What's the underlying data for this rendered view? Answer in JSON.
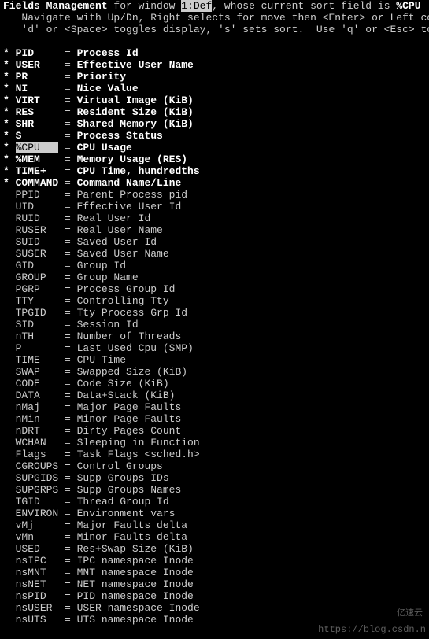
{
  "header": {
    "title_bold": "Fields Management",
    "for_window": " for window ",
    "window_label": "1:Def",
    "mid": ", whose current sort field is ",
    "sort_field": "%CPU",
    "help1": "   Navigate with Up/Dn, Right selects for move then <Enter> or Left commits,",
    "help2": "   'd' or <Space> toggles display, 's' sets sort.  Use 'q' or <Esc> to end!"
  },
  "fields": [
    {
      "on": true,
      "sel": false,
      "name": "PID",
      "desc": "Process Id"
    },
    {
      "on": true,
      "sel": false,
      "name": "USER",
      "desc": "Effective User Name"
    },
    {
      "on": true,
      "sel": false,
      "name": "PR",
      "desc": "Priority"
    },
    {
      "on": true,
      "sel": false,
      "name": "NI",
      "desc": "Nice Value"
    },
    {
      "on": true,
      "sel": false,
      "name": "VIRT",
      "desc": "Virtual Image (KiB)"
    },
    {
      "on": true,
      "sel": false,
      "name": "RES",
      "desc": "Resident Size (KiB)"
    },
    {
      "on": true,
      "sel": false,
      "name": "SHR",
      "desc": "Shared Memory (KiB)"
    },
    {
      "on": true,
      "sel": false,
      "name": "S",
      "desc": "Process Status"
    },
    {
      "on": true,
      "sel": true,
      "name": "%CPU",
      "desc": "CPU Usage"
    },
    {
      "on": true,
      "sel": false,
      "name": "%MEM",
      "desc": "Memory Usage (RES)"
    },
    {
      "on": true,
      "sel": false,
      "name": "TIME+",
      "desc": "CPU Time, hundredths"
    },
    {
      "on": true,
      "sel": false,
      "name": "COMMAND",
      "desc": "Command Name/Line"
    },
    {
      "on": false,
      "sel": false,
      "name": "PPID",
      "desc": "Parent Process pid"
    },
    {
      "on": false,
      "sel": false,
      "name": "UID",
      "desc": "Effective User Id"
    },
    {
      "on": false,
      "sel": false,
      "name": "RUID",
      "desc": "Real User Id"
    },
    {
      "on": false,
      "sel": false,
      "name": "RUSER",
      "desc": "Real User Name"
    },
    {
      "on": false,
      "sel": false,
      "name": "SUID",
      "desc": "Saved User Id"
    },
    {
      "on": false,
      "sel": false,
      "name": "SUSER",
      "desc": "Saved User Name"
    },
    {
      "on": false,
      "sel": false,
      "name": "GID",
      "desc": "Group Id"
    },
    {
      "on": false,
      "sel": false,
      "name": "GROUP",
      "desc": "Group Name"
    },
    {
      "on": false,
      "sel": false,
      "name": "PGRP",
      "desc": "Process Group Id"
    },
    {
      "on": false,
      "sel": false,
      "name": "TTY",
      "desc": "Controlling Tty"
    },
    {
      "on": false,
      "sel": false,
      "name": "TPGID",
      "desc": "Tty Process Grp Id"
    },
    {
      "on": false,
      "sel": false,
      "name": "SID",
      "desc": "Session Id"
    },
    {
      "on": false,
      "sel": false,
      "name": "nTH",
      "desc": "Number of Threads"
    },
    {
      "on": false,
      "sel": false,
      "name": "P",
      "desc": "Last Used Cpu (SMP)"
    },
    {
      "on": false,
      "sel": false,
      "name": "TIME",
      "desc": "CPU Time"
    },
    {
      "on": false,
      "sel": false,
      "name": "SWAP",
      "desc": "Swapped Size (KiB)"
    },
    {
      "on": false,
      "sel": false,
      "name": "CODE",
      "desc": "Code Size (KiB)"
    },
    {
      "on": false,
      "sel": false,
      "name": "DATA",
      "desc": "Data+Stack (KiB)"
    },
    {
      "on": false,
      "sel": false,
      "name": "nMaj",
      "desc": "Major Page Faults"
    },
    {
      "on": false,
      "sel": false,
      "name": "nMin",
      "desc": "Minor Page Faults"
    },
    {
      "on": false,
      "sel": false,
      "name": "nDRT",
      "desc": "Dirty Pages Count"
    },
    {
      "on": false,
      "sel": false,
      "name": "WCHAN",
      "desc": "Sleeping in Function"
    },
    {
      "on": false,
      "sel": false,
      "name": "Flags",
      "desc": "Task Flags <sched.h>"
    },
    {
      "on": false,
      "sel": false,
      "name": "CGROUPS",
      "desc": "Control Groups"
    },
    {
      "on": false,
      "sel": false,
      "name": "SUPGIDS",
      "desc": "Supp Groups IDs"
    },
    {
      "on": false,
      "sel": false,
      "name": "SUPGRPS",
      "desc": "Supp Groups Names"
    },
    {
      "on": false,
      "sel": false,
      "name": "TGID",
      "desc": "Thread Group Id"
    },
    {
      "on": false,
      "sel": false,
      "name": "ENVIRON",
      "desc": "Environment vars"
    },
    {
      "on": false,
      "sel": false,
      "name": "vMj",
      "desc": "Major Faults delta"
    },
    {
      "on": false,
      "sel": false,
      "name": "vMn",
      "desc": "Minor Faults delta"
    },
    {
      "on": false,
      "sel": false,
      "name": "USED",
      "desc": "Res+Swap Size (KiB)"
    },
    {
      "on": false,
      "sel": false,
      "name": "nsIPC",
      "desc": "IPC namespace Inode"
    },
    {
      "on": false,
      "sel": false,
      "name": "nsMNT",
      "desc": "MNT namespace Inode"
    },
    {
      "on": false,
      "sel": false,
      "name": "nsNET",
      "desc": "NET namespace Inode"
    },
    {
      "on": false,
      "sel": false,
      "name": "nsPID",
      "desc": "PID namespace Inode"
    },
    {
      "on": false,
      "sel": false,
      "name": "nsUSER",
      "desc": "USER namespace Inode"
    },
    {
      "on": false,
      "sel": false,
      "name": "nsUTS",
      "desc": "UTS namespace Inode"
    }
  ],
  "watermark": "https://blog.csdn.n",
  "logo": "亿速云"
}
